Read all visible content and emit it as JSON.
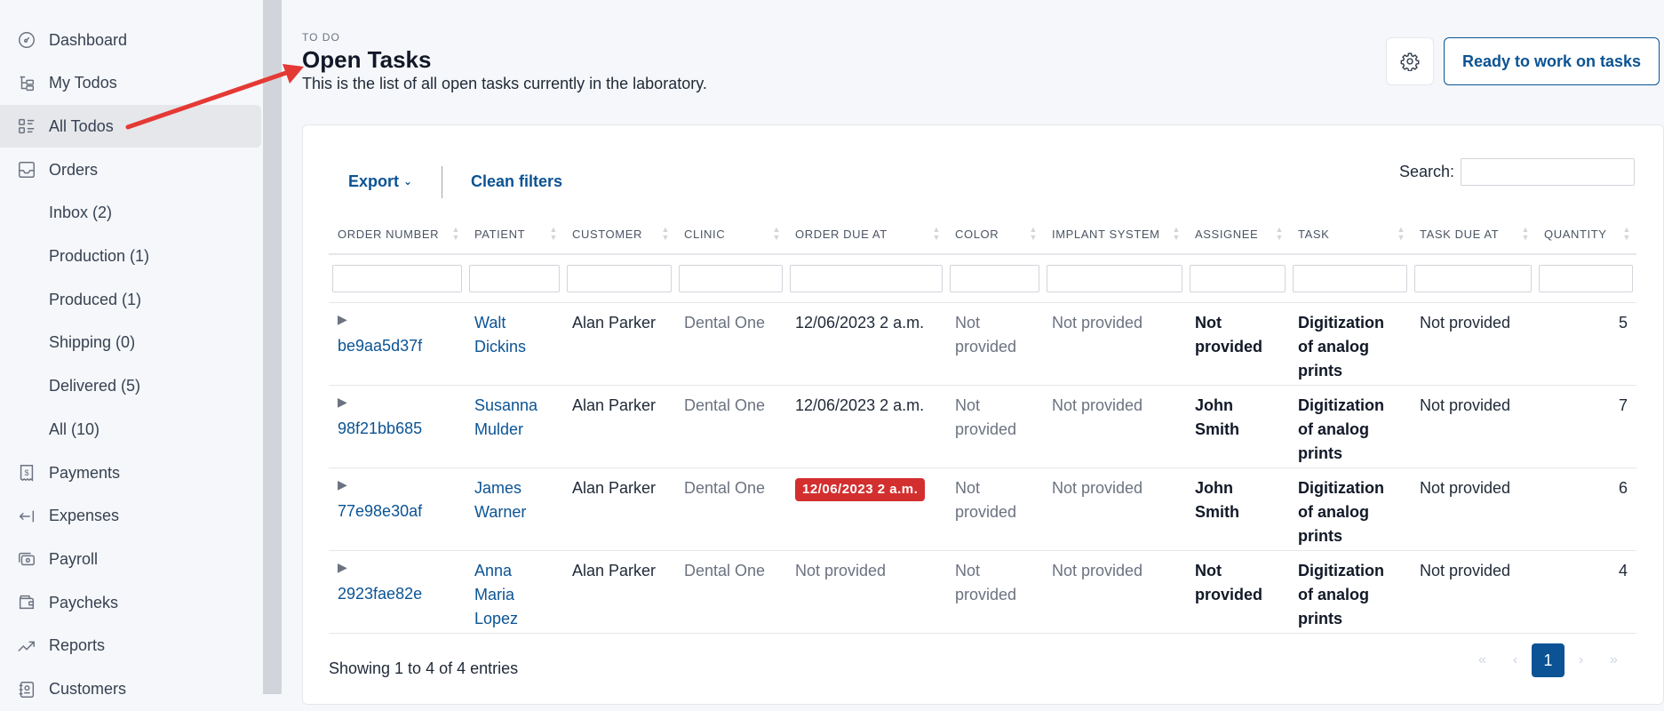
{
  "sidebar": {
    "items": [
      {
        "label": "Dashboard",
        "icon": "dashboard-icon"
      },
      {
        "label": "My Todos",
        "icon": "tree-list-icon"
      },
      {
        "label": "All Todos",
        "icon": "list-icon",
        "active": true
      },
      {
        "label": "Orders",
        "icon": "inbox-icon"
      },
      {
        "label": "Inbox (2)"
      },
      {
        "label": "Production (1)"
      },
      {
        "label": "Produced (1)"
      },
      {
        "label": "Shipping (0)"
      },
      {
        "label": "Delivered (5)"
      },
      {
        "label": "All (10)"
      },
      {
        "label": "Payments",
        "icon": "receipt-icon"
      },
      {
        "label": "Expenses",
        "icon": "arrow-left-bar-icon"
      },
      {
        "label": "Payroll",
        "icon": "cash-icon"
      },
      {
        "label": "Paycheks",
        "icon": "wallet-icon"
      },
      {
        "label": "Reports",
        "icon": "trend-icon"
      },
      {
        "label": "Customers",
        "icon": "address-book-icon"
      }
    ]
  },
  "header": {
    "eyebrow": "TO DO",
    "title": "Open Tasks",
    "subtitle": "This is the list of all open tasks currently in the laboratory.",
    "settings_icon": "gear-icon",
    "ready_button": "Ready to work on tasks"
  },
  "toolbar": {
    "export_label": "Export",
    "clean_filters_label": "Clean filters",
    "search_label": "Search:",
    "search_value": ""
  },
  "table": {
    "columns": [
      "ORDER NUMBER",
      "PATIENT",
      "CUSTOMER",
      "CLINIC",
      "ORDER DUE AT",
      "COLOR",
      "IMPLANT SYSTEM",
      "ASSIGNEE",
      "TASK",
      "TASK DUE AT",
      "QUANTITY"
    ],
    "rows": [
      {
        "order_number": "be9aa5d37f",
        "patient": "Walt Dickins",
        "customer": "Alan Parker",
        "clinic": "Dental One",
        "order_due_at": "12/06/2023 2 a.m.",
        "overdue": false,
        "color": "Not provided",
        "implant_system": "Not provided",
        "assignee": "Not provided",
        "task": "Digitization of analog prints",
        "task_due_at": "Not provided",
        "quantity": "5"
      },
      {
        "order_number": "98f21bb685",
        "patient": "Susanna Mulder",
        "customer": "Alan Parker",
        "clinic": "Dental One",
        "order_due_at": "12/06/2023 2 a.m.",
        "overdue": false,
        "color": "Not provided",
        "implant_system": "Not provided",
        "assignee": "John Smith",
        "task": "Digitization of analog prints",
        "task_due_at": "Not provided",
        "quantity": "7"
      },
      {
        "order_number": "77e98e30af",
        "patient": "James Warner",
        "customer": "Alan Parker",
        "clinic": "Dental One",
        "order_due_at": "12/06/2023 2 a.m.",
        "overdue": true,
        "color": "Not provided",
        "implant_system": "Not provided",
        "assignee": "John Smith",
        "task": "Digitization of analog prints",
        "task_due_at": "Not provided",
        "quantity": "6"
      },
      {
        "order_number": "2923fae82e",
        "patient": "Anna Maria Lopez",
        "customer": "Alan Parker",
        "clinic": "Dental One",
        "order_due_at": "Not provided",
        "overdue": false,
        "color": "Not provided",
        "implant_system": "Not provided",
        "assignee": "Not provided",
        "task": "Digitization of analog prints",
        "task_due_at": "Not provided",
        "quantity": "4"
      }
    ]
  },
  "footer": {
    "info": "Showing 1 to 4 of 4 entries",
    "pagination": {
      "first": "«",
      "prev": "‹",
      "current": "1",
      "next": "›",
      "last": "»"
    }
  },
  "colors": {
    "brand": "#0b5394",
    "overdue": "#d32f2f",
    "annotation_arrow": "#e53935"
  }
}
